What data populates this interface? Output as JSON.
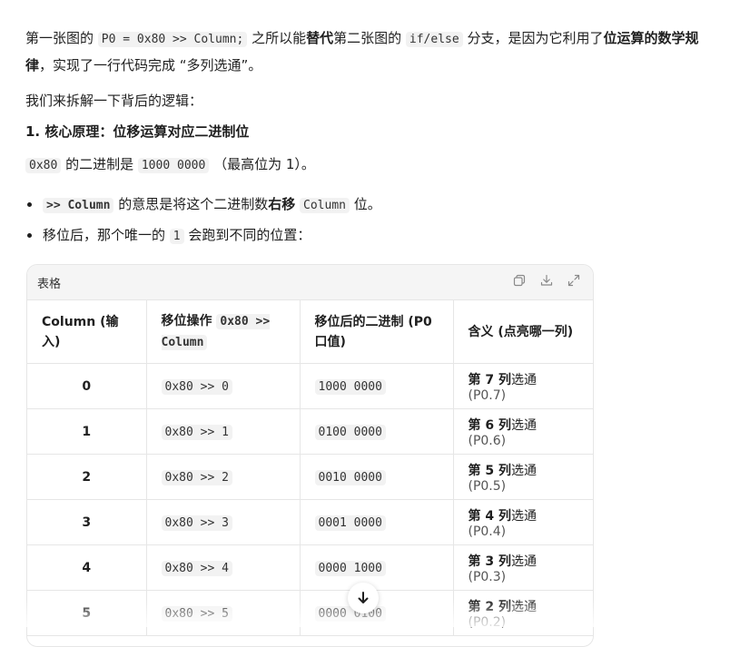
{
  "para1": {
    "t1": "第一张图的 ",
    "code1": "P0 = 0x80 >> Column;",
    "t2": " 之所以能",
    "b1": "替代",
    "t3": "第二张图的 ",
    "code2": "if/else",
    "t4": " 分支，是因为它利用了",
    "b2": "位运算的数学规律",
    "t5": "，实现了一行代码完成 “多列选通”。"
  },
  "para2": "我们来拆解一下背后的逻辑：",
  "heading": "1. 核心原理：位移运算对应二进制位",
  "para3": {
    "code1": "0x80",
    "t1": " 的二进制是 ",
    "code2": "1000 0000",
    "t2": " （最高位为 1）。"
  },
  "bullets": [
    {
      "code1": ">> Column",
      "t1": " 的意思是将这个二进制数",
      "b1": "右移",
      "t2": " ",
      "code2": "Column",
      "t3": " 位。"
    },
    {
      "t1": "移位后，那个唯一的 ",
      "code1": "1",
      "t2": " 会跑到不同的位置："
    }
  ],
  "table": {
    "title": "表格",
    "headers": [
      {
        "text": "Column (输入)"
      },
      {
        "text": "移位操作 ",
        "code": "0x80 >> Column"
      },
      {
        "text": "移位后的二进制 (P0 口值)"
      },
      {
        "text": "含义 (点亮哪一列)"
      }
    ],
    "rows": [
      {
        "col": "0",
        "op": "0x80 >> 0",
        "bin": "1000 0000",
        "m_strong": "第 7 列",
        "m_text": "选通",
        "m_dim": " (P0.7)"
      },
      {
        "col": "1",
        "op": "0x80 >> 1",
        "bin": "0100 0000",
        "m_strong": "第 6 列",
        "m_text": "选通",
        "m_dim": " (P0.6)"
      },
      {
        "col": "2",
        "op": "0x80 >> 2",
        "bin": "0010 0000",
        "m_strong": "第 5 列",
        "m_text": "选通",
        "m_dim": " (P0.5)"
      },
      {
        "col": "3",
        "op": "0x80 >> 3",
        "bin": "0001 0000",
        "m_strong": "第 4 列",
        "m_text": "选通",
        "m_dim": " (P0.4)"
      },
      {
        "col": "4",
        "op": "0x80 >> 4",
        "bin": "0000 1000",
        "m_strong": "第 3 列",
        "m_text": "选通",
        "m_dim": " (P0.3)"
      },
      {
        "col": "5",
        "op": "0x80 >> 5",
        "bin": "0000 0100",
        "m_strong": "第 2 列",
        "m_text": "选通",
        "m_dim": " (P0.2)"
      }
    ],
    "icons": [
      "copy-icon",
      "download-icon",
      "expand-icon"
    ]
  },
  "scroll_button": {
    "icon": "arrow-down-icon"
  }
}
